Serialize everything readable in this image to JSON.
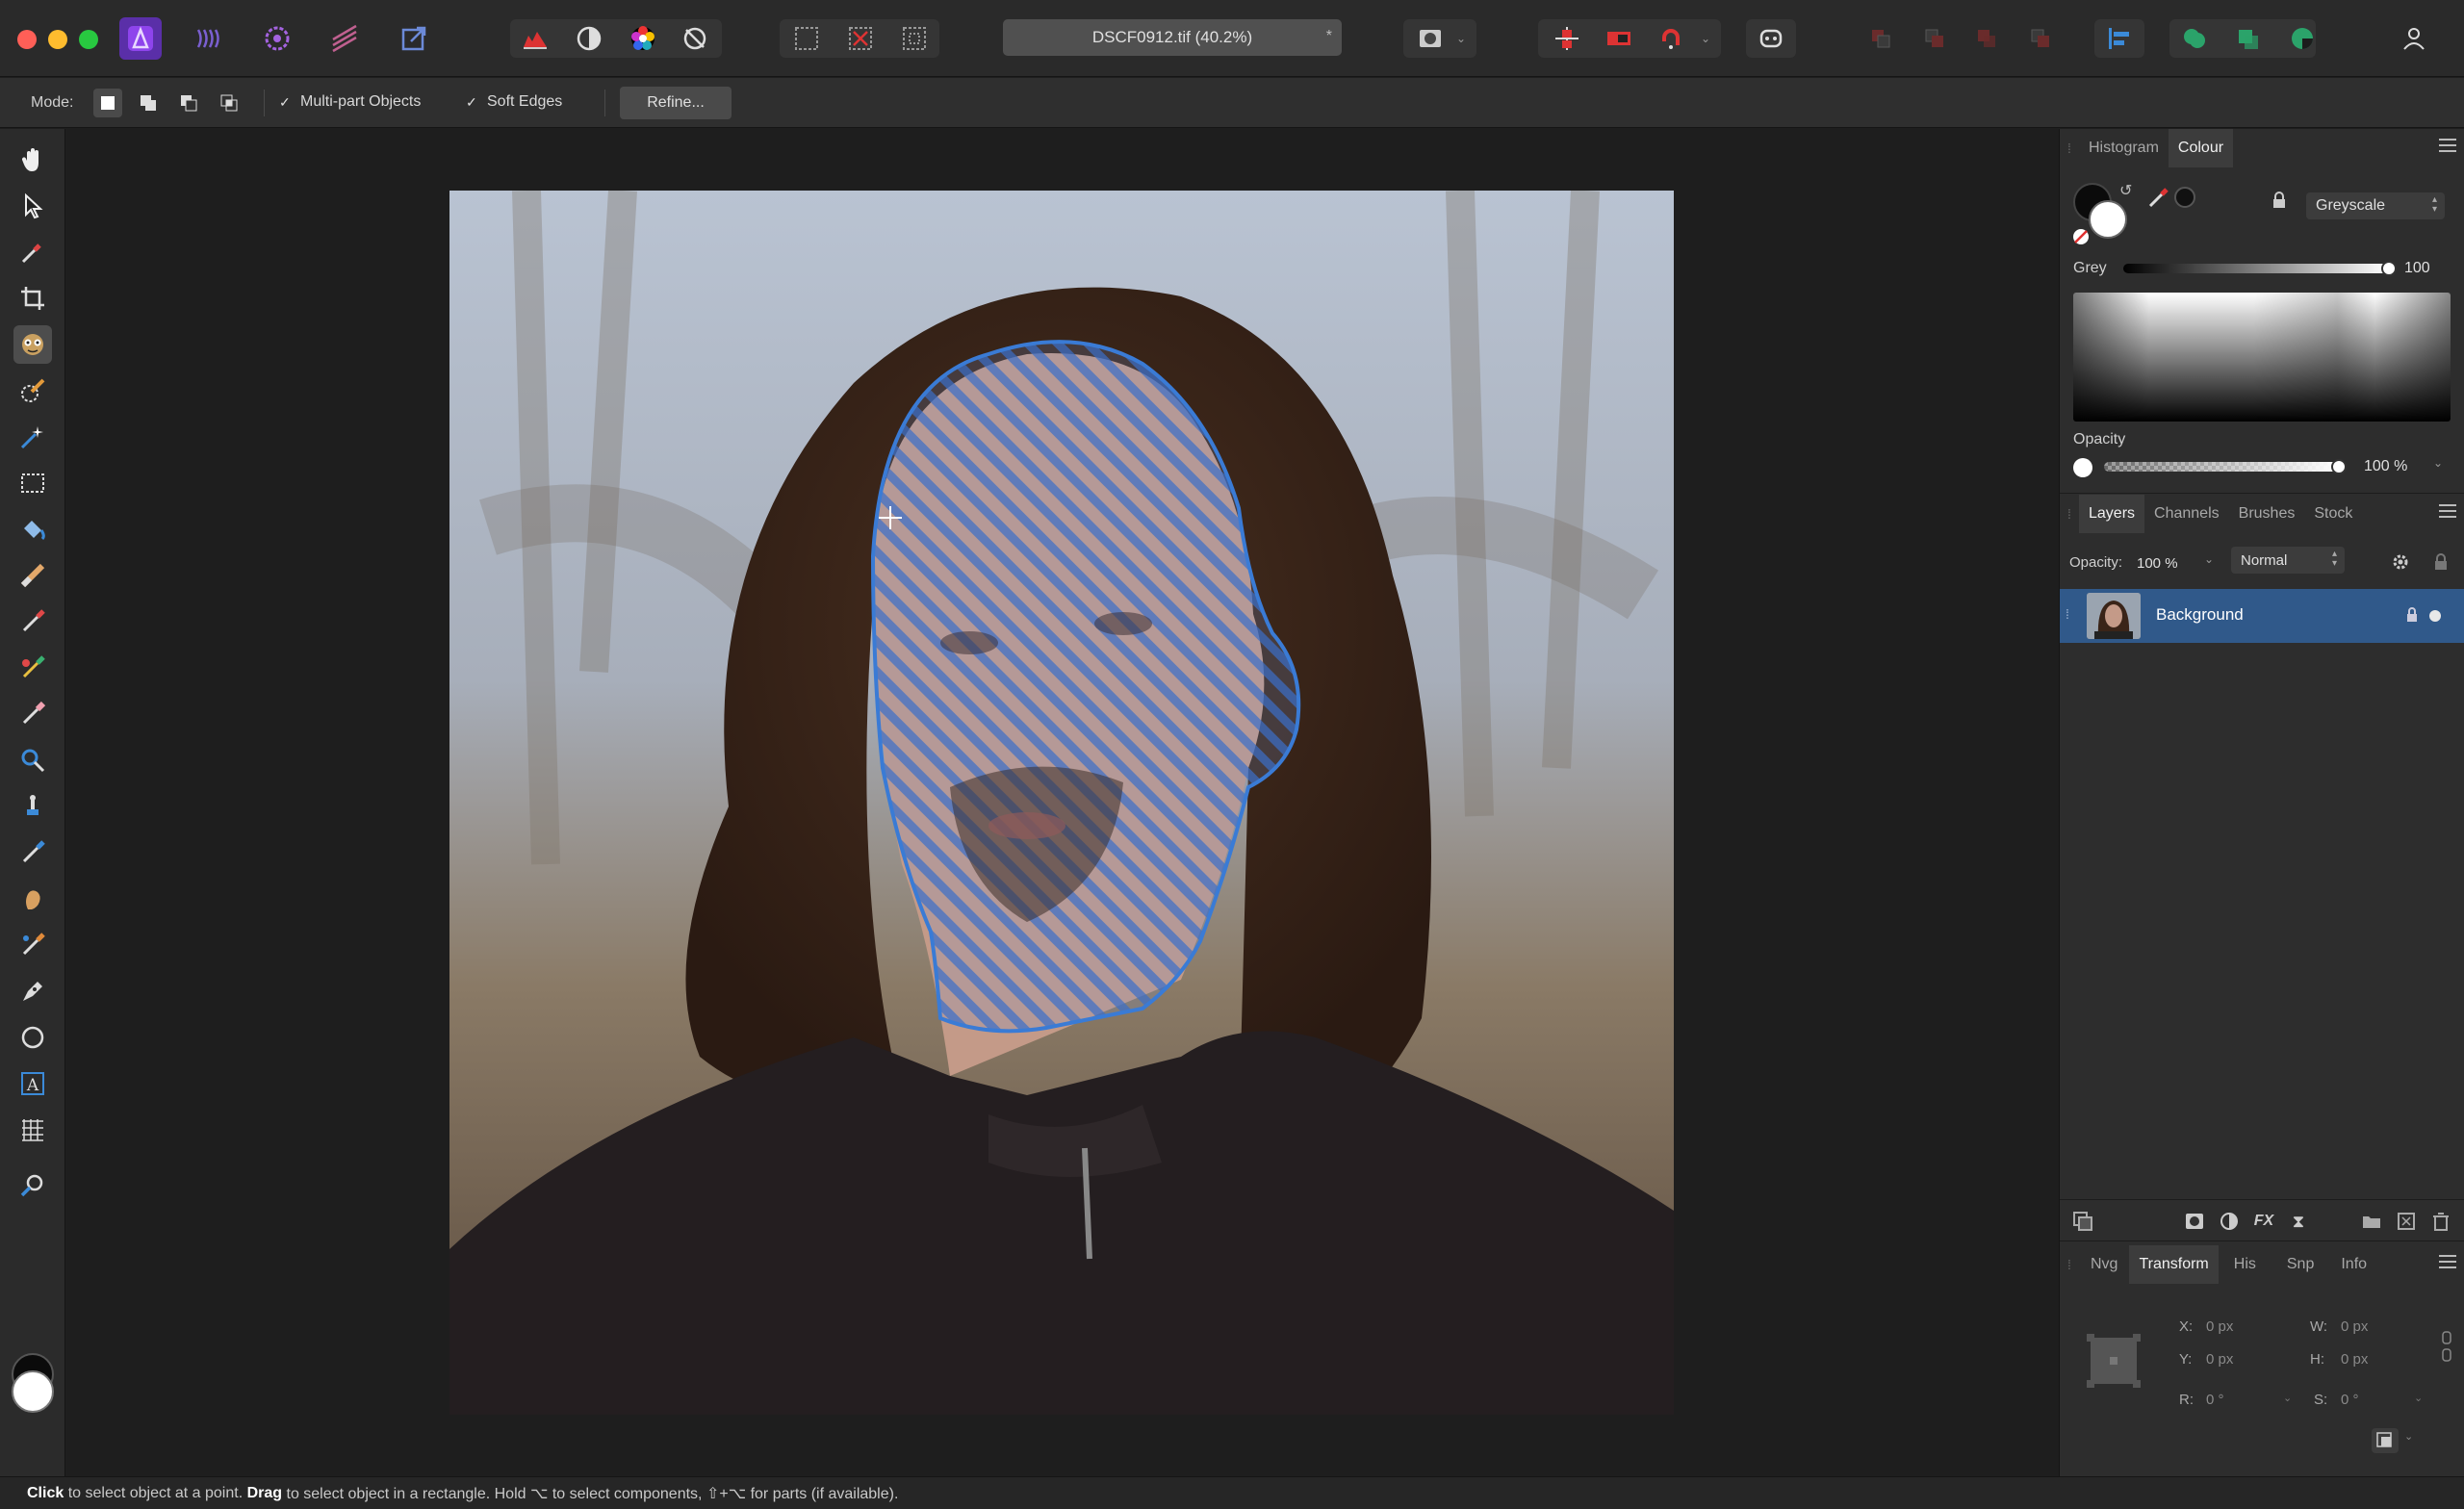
{
  "document": {
    "title": "DSCF0912.tif (40.2%)",
    "modified_marker": "*"
  },
  "context_toolbar": {
    "mode_label": "Mode:",
    "multipart_label": "Multi-part Objects",
    "multipart_checked": true,
    "soft_edges_label": "Soft Edges",
    "soft_edges_checked": true,
    "refine_label": "Refine..."
  },
  "panels": {
    "colour": {
      "tabs": [
        "Histogram",
        "Colour"
      ],
      "active_tab": "Colour",
      "model": "Greyscale",
      "grey_label": "Grey",
      "grey_value": "100",
      "opacity_label": "Opacity",
      "opacity_value": "100 %"
    },
    "layers": {
      "tabs": [
        "Layers",
        "Channels",
        "Brushes",
        "Stock"
      ],
      "active_tab": "Layers",
      "opacity_label": "Opacity:",
      "opacity_value": "100 %",
      "blend_mode": "Normal",
      "items": [
        {
          "name": "Background",
          "locked": true,
          "visible": true,
          "selected": true
        }
      ]
    },
    "transform": {
      "tabs": [
        "Nvg",
        "Transform",
        "His",
        "Snp",
        "Info"
      ],
      "active_tab": "Transform",
      "x_label": "X:",
      "x_value": "0 px",
      "y_label": "Y:",
      "y_value": "0 px",
      "w_label": "W:",
      "w_value": "0 px",
      "h_label": "H:",
      "h_value": "0 px",
      "r_label": "R:",
      "r_value": "0 °",
      "s_label": "S:",
      "s_value": "0 °"
    }
  },
  "status": {
    "click_word": "Click",
    "click_text": " to select object at a point. ",
    "drag_word": "Drag",
    "drag_text": " to select object in a rectangle. Hold ⌥ to select components, ⇧+⌥ for parts (if available)."
  },
  "colors": {
    "selection_accent": "#3a7bd5",
    "layer_selected": "#30598a",
    "app_purple": "#7b3fd6"
  }
}
